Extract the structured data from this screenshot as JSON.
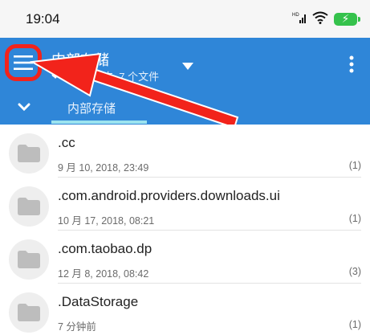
{
  "status_bar": {
    "time": "19:04",
    "signal_label": "HD",
    "battery_glyph": "⚡"
  },
  "app_bar": {
    "title": "内部存储",
    "subtitle": "夹, 7 个文件",
    "tab_label": "内部存储",
    "accent_color": "#2f86d8",
    "annotation_color": "#f2231b"
  },
  "files": [
    {
      "name": ".cc",
      "date": "9 月 10, 2018, 23:49",
      "count": "(1)"
    },
    {
      "name": ".com.android.providers.downloads.ui",
      "date": "10 月 17, 2018, 08:21",
      "count": "(1)"
    },
    {
      "name": ".com.taobao.dp",
      "date": "12 月 8, 2018, 08:42",
      "count": "(3)"
    },
    {
      "name": ".DataStorage",
      "date": "7 分钟前",
      "count": "(1)"
    }
  ]
}
